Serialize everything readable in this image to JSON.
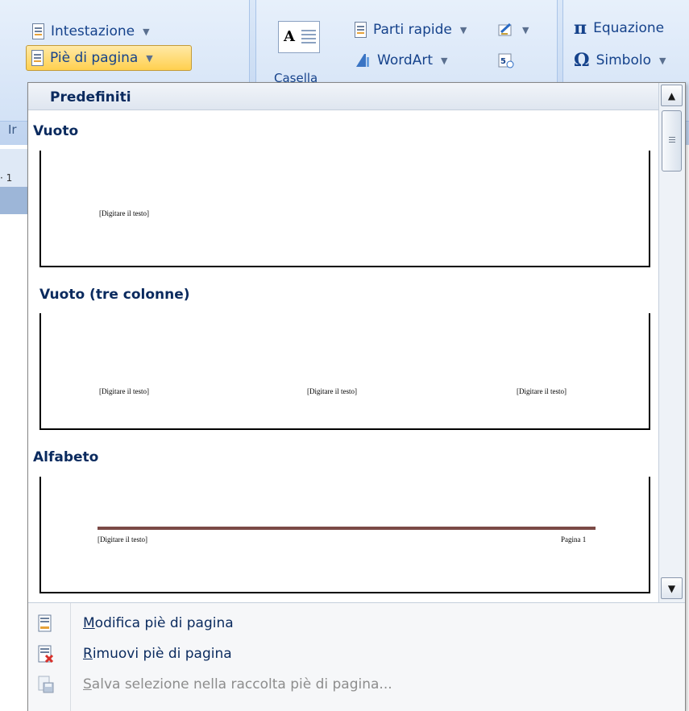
{
  "ribbon": {
    "intestazione_label": "Intestazione",
    "pie_label": "Piè di pagina",
    "casella_label": "Casella",
    "parti_rapide_label": "Parti rapide",
    "wordart_label": "WordArt",
    "equazione_label": "Equazione",
    "simbolo_label": "Simbolo",
    "group_label_fragment": "Ir",
    "ruler_number": "· 1",
    "pi_symbol": "π",
    "omega_symbol": "Ω",
    "casella_glyph": "A"
  },
  "gallery": {
    "header": "Predefiniti",
    "sections": [
      {
        "title": "Vuoto",
        "placeholders": [
          "[Digitare il testo]"
        ]
      },
      {
        "title": "Vuoto (tre colonne)",
        "placeholders": [
          "[Digitare il testo]",
          "[Digitare il testo]",
          "[Digitare il testo]"
        ]
      },
      {
        "title": "Alfabeto",
        "placeholders": [
          "[Digitare il testo]"
        ],
        "page_label": "Pagina 1",
        "rule_color": "#7b4a46"
      }
    ]
  },
  "menu": {
    "items": [
      {
        "first": "M",
        "rest": "odifica piè di pagina",
        "enabled": true,
        "icon": "edit-footer-icon"
      },
      {
        "first": "R",
        "rest": "imuovi piè di pagina",
        "enabled": true,
        "icon": "remove-footer-icon"
      },
      {
        "first": "S",
        "rest": "alva selezione nella raccolta piè di pagina...",
        "enabled": false,
        "icon": "save-selection-icon"
      }
    ]
  },
  "colors": {
    "accent": "#15428b",
    "active_button": "#ffd04f",
    "ribbon": "#c9dbf3"
  }
}
